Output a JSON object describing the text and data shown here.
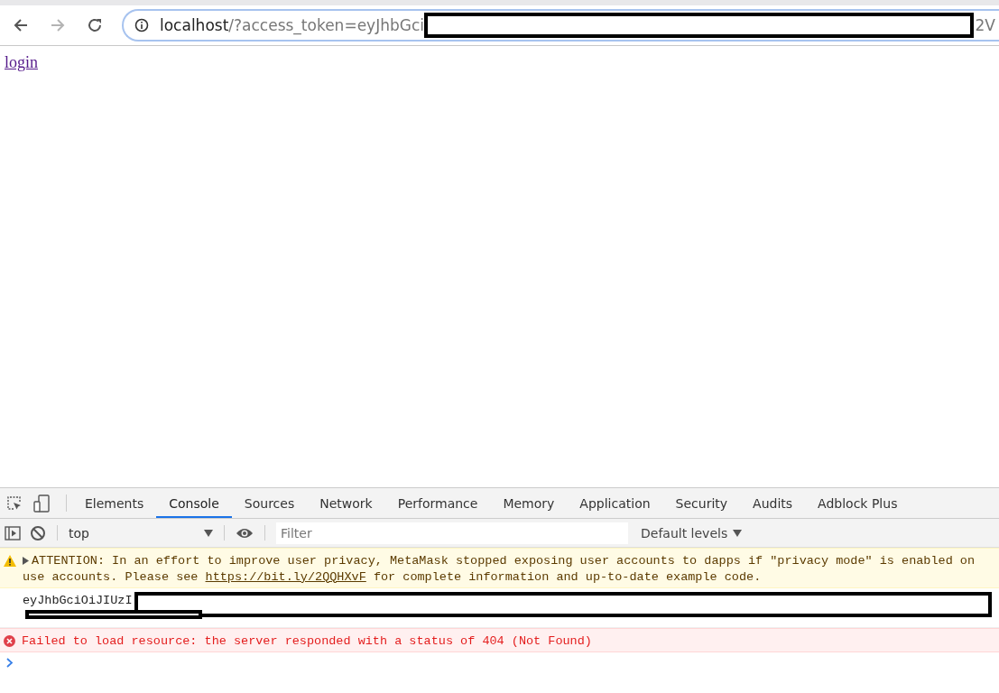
{
  "browser": {
    "back_disabled": false,
    "forward_disabled": true,
    "url_host": "localhost",
    "url_path": "/?access_token=eyJhbGci",
    "url_tail": "2V"
  },
  "page": {
    "link": "login"
  },
  "devtools": {
    "tabs": [
      {
        "label": "Elements",
        "selected": false
      },
      {
        "label": "Console",
        "selected": true
      },
      {
        "label": "Sources",
        "selected": false
      },
      {
        "label": "Network",
        "selected": false
      },
      {
        "label": "Performance",
        "selected": false
      },
      {
        "label": "Memory",
        "selected": false
      },
      {
        "label": "Application",
        "selected": false
      },
      {
        "label": "Security",
        "selected": false
      },
      {
        "label": "Audits",
        "selected": false
      },
      {
        "label": "Adblock Plus",
        "selected": false
      }
    ],
    "context": "top",
    "filter_placeholder": "Filter",
    "levels": "Default levels",
    "messages": [
      {
        "kind": "warning",
        "line1": "ATTENTION: In an effort to improve user privacy, MetaMask stopped exposing user accounts to dapps if \"privacy mode\" is enabled on",
        "line2_before": "use accounts. Please see ",
        "link": "https://bit.ly/2QQHXvF",
        "line2_after": " for complete information and up-to-date example code."
      },
      {
        "kind": "log",
        "text": "eyJhbGciOiJIUzI"
      },
      {
        "kind": "error",
        "text": "Failed to load resource: the server responded with a status of 404 (Not Found)"
      }
    ]
  }
}
